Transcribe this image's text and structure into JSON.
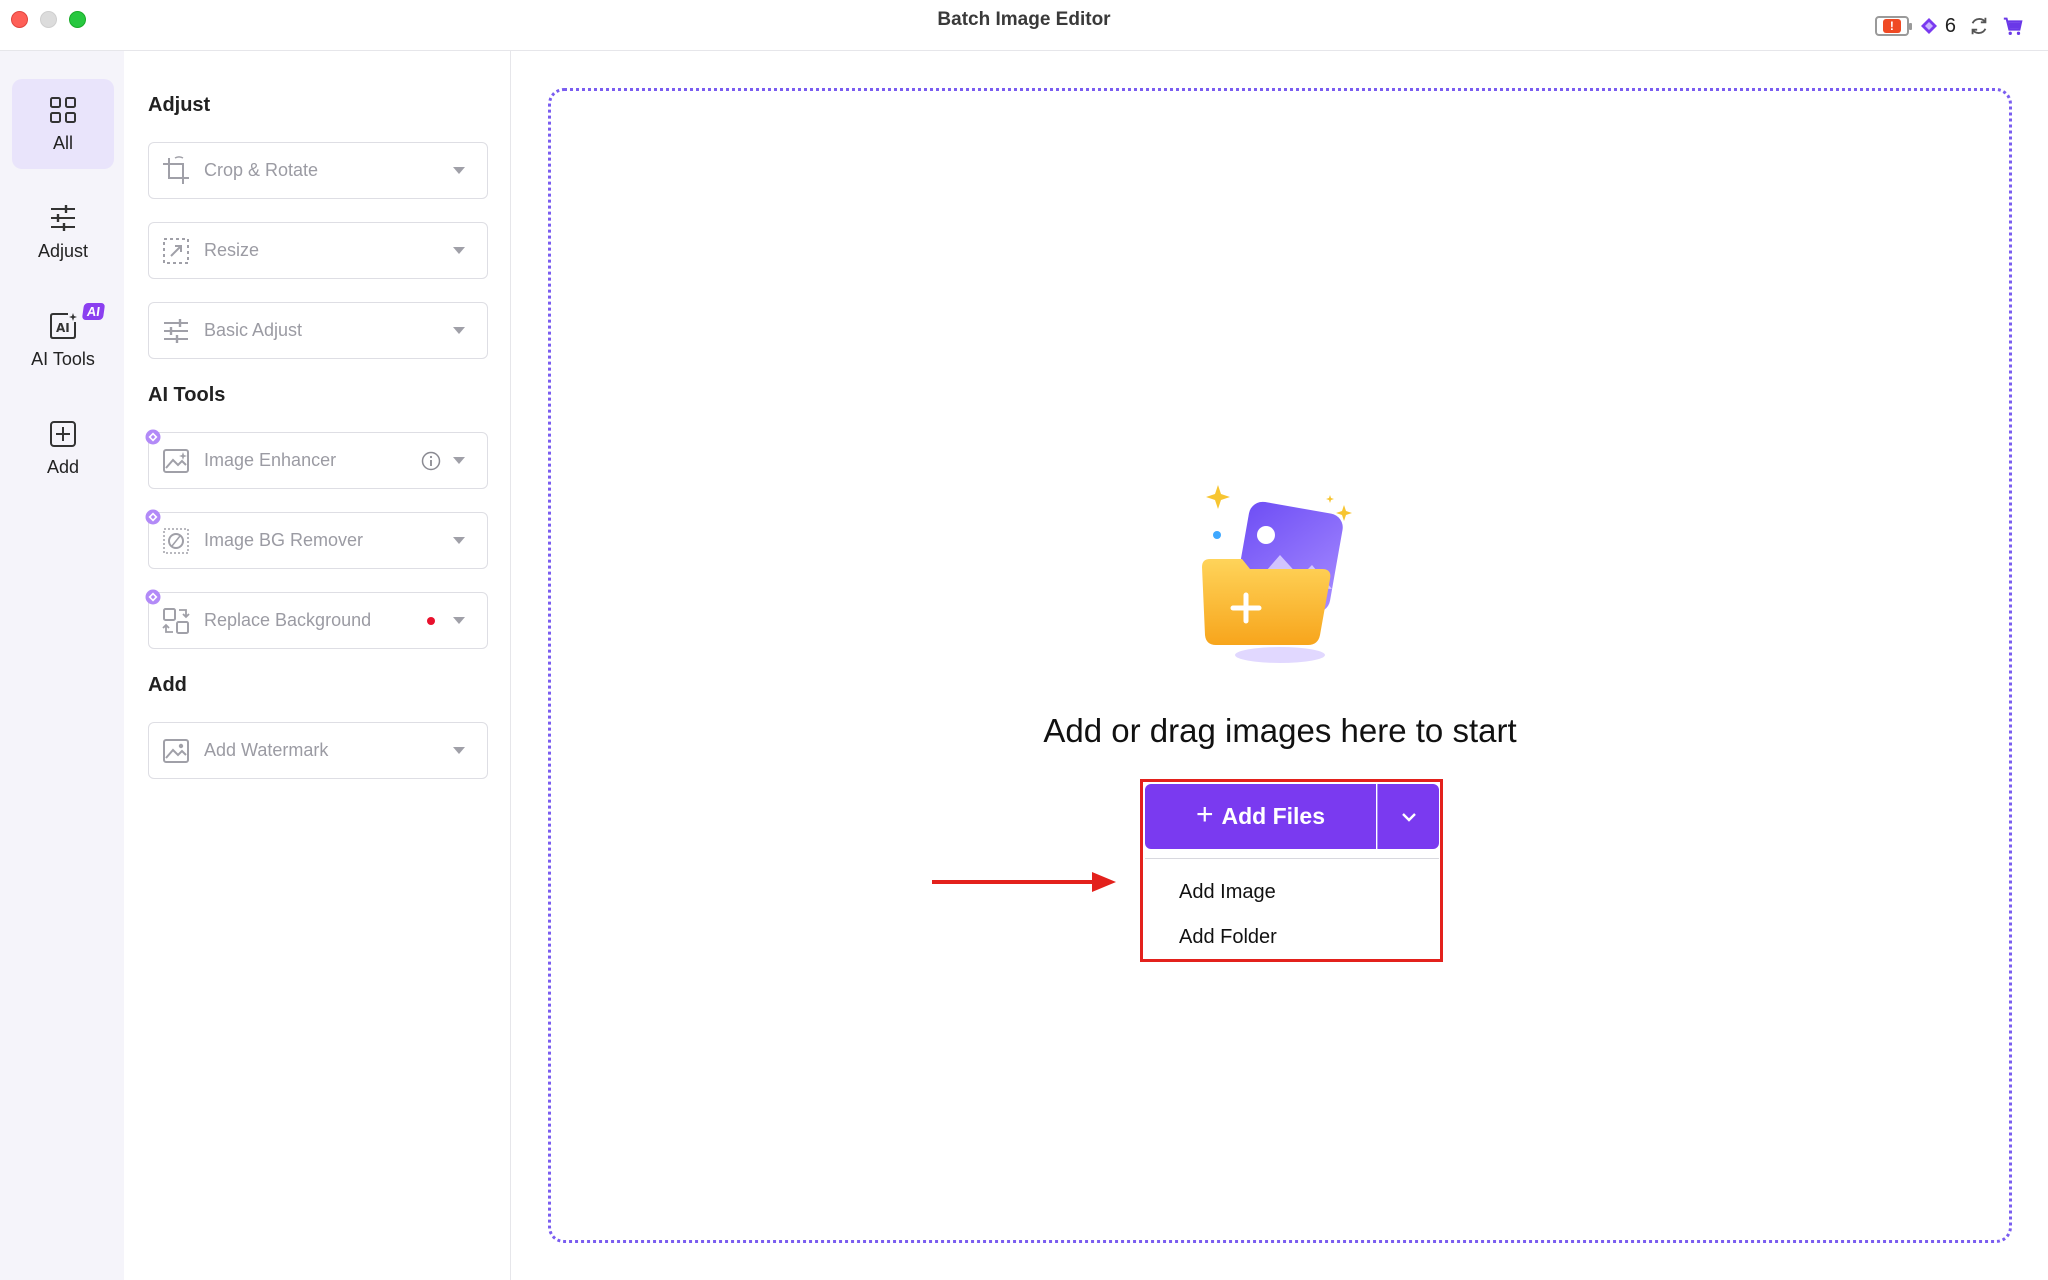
{
  "window": {
    "title": "Batch Image Editor",
    "credits": "6",
    "battery_warning": "!"
  },
  "rail": {
    "items": [
      {
        "label": "All",
        "icon": "grid-icon",
        "active": true
      },
      {
        "label": "Adjust",
        "icon": "sliders-icon"
      },
      {
        "label": "AI Tools",
        "icon": "ai-image-icon",
        "badge": "AI"
      },
      {
        "label": "Add",
        "icon": "plus-square-icon"
      }
    ]
  },
  "panel": {
    "sections": {
      "adjust": "Adjust",
      "ai_tools": "AI Tools",
      "add": "Add"
    },
    "tools": {
      "crop_rotate": "Crop & Rotate",
      "resize": "Resize",
      "basic_adjust": "Basic Adjust",
      "image_enhancer": "Image Enhancer",
      "image_bg_remover": "Image BG Remover",
      "replace_background": "Replace Background",
      "add_watermark": "Add Watermark"
    }
  },
  "main": {
    "drop_text": "Add or drag images here to start",
    "add_files_label": "Add Files",
    "menu": {
      "add_image": "Add Image",
      "add_folder": "Add Folder"
    }
  },
  "colors": {
    "accent": "#7a3af0",
    "highlight": "#e3211c",
    "dropzone_border": "#7a5df0"
  }
}
